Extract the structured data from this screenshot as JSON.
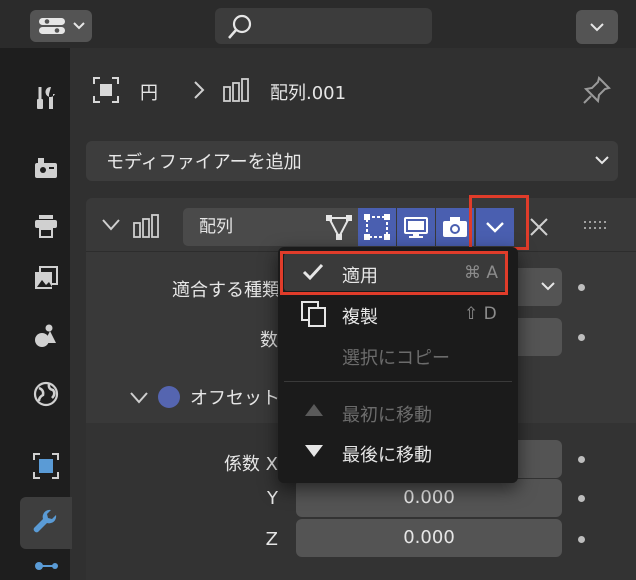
{
  "header": {
    "search_placeholder": ""
  },
  "tabs": [
    "tool",
    "render",
    "output",
    "view-layer",
    "scene",
    "world",
    "object",
    "modifiers",
    "particles"
  ],
  "breadcrumb": {
    "object": "円",
    "separator": "›",
    "modifier": "配列.001"
  },
  "add_modifier": {
    "label": "モディファイアーを追加"
  },
  "modifier": {
    "name": "配列"
  },
  "props": {
    "fit_type_label": "適合する種類",
    "count_label": "数",
    "offset_label": "オフセット",
    "factor_x_label": "係数 X",
    "y_label": "Y",
    "z_label": "Z",
    "y_value": "0.000",
    "z_value": "0.000"
  },
  "menu": {
    "apply": "適用",
    "apply_shortcut": "⌘ A",
    "duplicate": "複製",
    "duplicate_shortcut": "⇧ D",
    "copy_to_selected": "選択にコピー",
    "move_first": "最初に移動",
    "move_last": "最後に移動"
  },
  "colors": {
    "accent_blue": "#4a5fb0",
    "highlight_red": "#e03c2a"
  }
}
